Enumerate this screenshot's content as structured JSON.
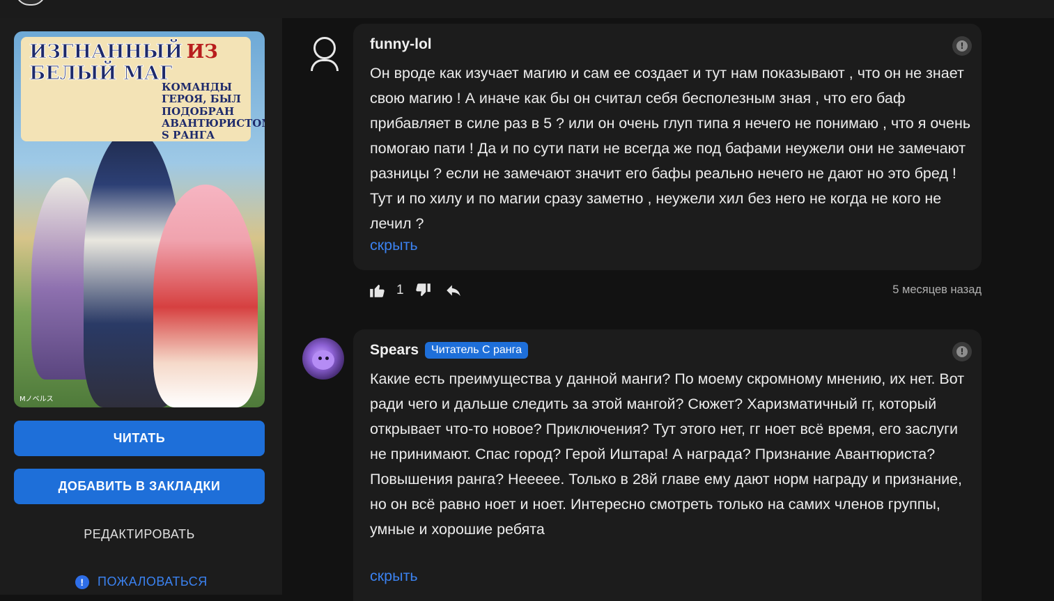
{
  "sidebar": {
    "cover": {
      "title_line1a": "ИЗГНАННЫЙ",
      "title_line1b": "ИЗ",
      "title_line2": "БЕЛЫЙ МАГ",
      "title_side": "КОМАНДЫ ГЕРОЯ, БЫЛ ПОДОБРАН АВАНТЮРИСТОМ S РАНГА",
      "publisher_mark": "Mノベルス"
    },
    "read_button": "ЧИТАТЬ",
    "bookmark_button": "ДОБАВИТЬ В ЗАКЛАДКИ",
    "edit_link": "РЕДАКТИРОВАТЬ",
    "report_link": "ПОЖАЛОВАТЬСЯ",
    "accent_color": "#1e6fd9"
  },
  "comments": [
    {
      "username": "funny-lol",
      "badge": "",
      "avatar": "default-user-icon",
      "text": "Он вроде как изучает магию и сам ее создает и тут нам показывают , что он не знает свою магию ! А иначе как бы он считал себя бесполезным зная , что его баф прибавляет в силе раз в 5 ? или он очень глуп типа я нечего не понимаю , что я очень помогаю пати ! Да и по сути пати не всегда же под бафами неужели они не замечают разницы ? если не замечают значит его бафы реально нечего не дают но это бред ! Тут и по хилу и по магии сразу заметно , неужели хил без него не когда не кого не лечил ?",
      "hide_label": "скрыть",
      "likes": "1",
      "time": "5 месяцев назад"
    },
    {
      "username": "Spears",
      "badge": "Читатель С ранга",
      "avatar": "purple-plush-avatar",
      "text": "Какие есть преимущества у данной манги? По моему скромному мнению, их нет. Вот ради чего и дальше следить за этой мангой? Сюжет? Харизматичный гг, который открывает что-то новое? Приключения? Тут этого нет, гг ноет всё время, его заслуги не принимают. Спас город? Герой Иштара! А награда? Признание Авантюриста? Повышения ранга? Неееее. Только в 28й главе ему дают норм награду и признание, но он всё равно ноет и ноет. Интересно смотреть только на самих членов группы, умные и хорошие ребята",
      "hide_label": "скрыть"
    }
  ]
}
